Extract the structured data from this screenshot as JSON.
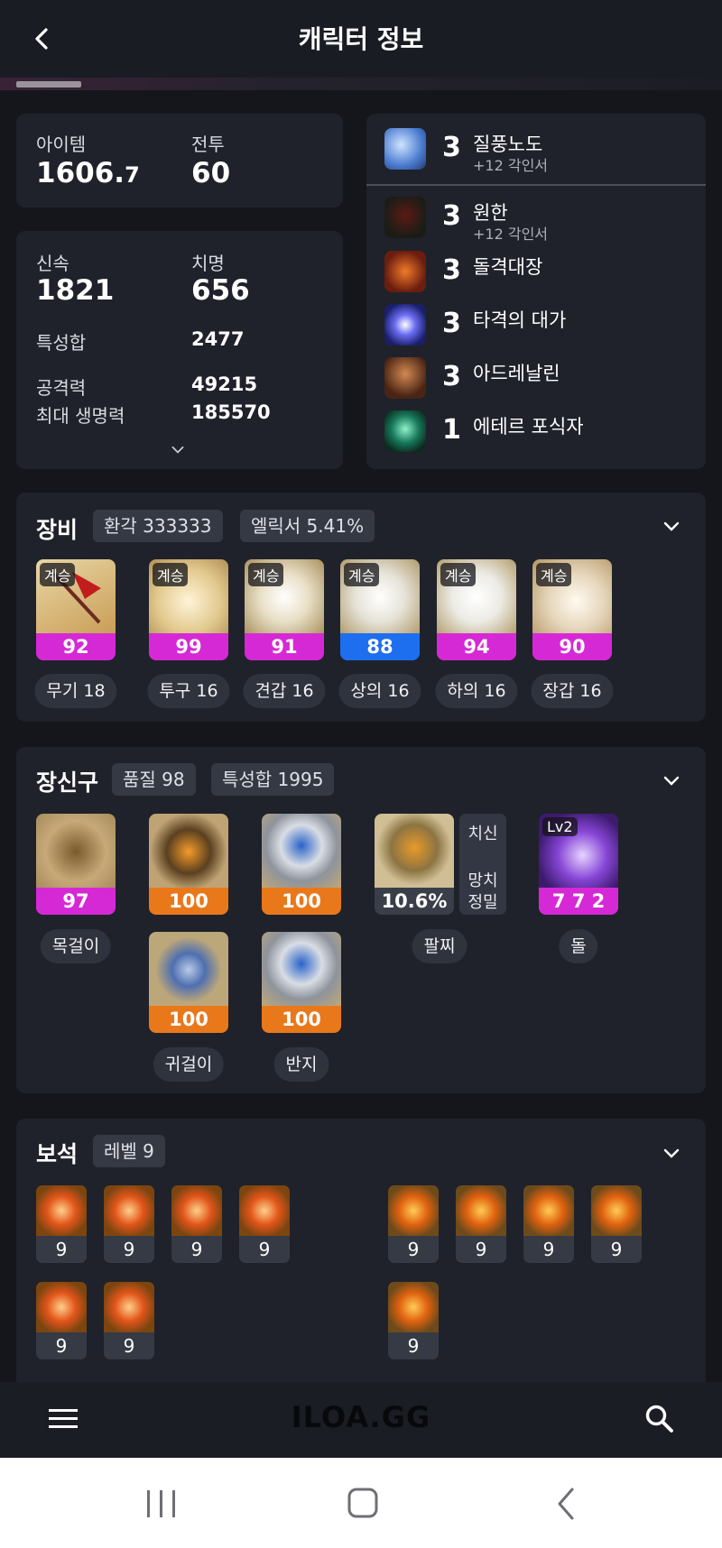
{
  "header": {
    "title": "캐릭터 정보"
  },
  "stats_top": {
    "item_label": "아이템",
    "item_value": "1606.",
    "item_value_decimal": "7",
    "combat_label": "전투",
    "combat_value": "60"
  },
  "stats": {
    "swiftness_label": "신속",
    "swiftness_value": "1821",
    "crit_label": "치명",
    "crit_value": "656",
    "total_label": "특성합",
    "total_value": "2477",
    "attack_label": "공격력",
    "attack_value": "49215",
    "hp_label": "최대 생명력",
    "hp_value": "185570"
  },
  "engravings": [
    {
      "level": "3",
      "name": "질풍노도",
      "sub": "+12 각인서",
      "icon": "wind-engraving-icon"
    },
    {
      "level": "3",
      "name": "원한",
      "sub": "+12 각인서",
      "icon": "grudge-engraving-icon"
    },
    {
      "level": "3",
      "name": "돌격대장",
      "sub": "",
      "icon": "raid-captain-engraving-icon"
    },
    {
      "level": "3",
      "name": "타격의 대가",
      "sub": "",
      "icon": "hit-master-engraving-icon"
    },
    {
      "level": "3",
      "name": "아드레날린",
      "sub": "",
      "icon": "adrenaline-engraving-icon"
    },
    {
      "level": "1",
      "name": "에테르 포식자",
      "sub": "",
      "icon": "ether-predator-engraving-icon"
    }
  ],
  "equipment": {
    "title": "장비",
    "pill1": "환각 333333",
    "pill2": "엘릭서 5.41%",
    "items": [
      {
        "tag": "계승",
        "quality": "92",
        "caption": "무기 18",
        "color": "#d629d6"
      },
      {
        "tag": "계승",
        "quality": "99",
        "caption": "투구 16",
        "color": "#d629d6"
      },
      {
        "tag": "계승",
        "quality": "91",
        "caption": "견갑 16",
        "color": "#d629d6"
      },
      {
        "tag": "계승",
        "quality": "88",
        "caption": "상의 16",
        "color": "#1e6ef0"
      },
      {
        "tag": "계승",
        "quality": "94",
        "caption": "하의 16",
        "color": "#d629d6"
      },
      {
        "tag": "계승",
        "quality": "90",
        "caption": "장갑 16",
        "color": "#d629d6"
      }
    ]
  },
  "accessories": {
    "title": "장신구",
    "pill1": "품질 98",
    "pill2": "특성합 1995",
    "necklace": {
      "quality": "97",
      "caption": "목걸이"
    },
    "earring1": {
      "quality": "100"
    },
    "earring2": {
      "quality": "100",
      "caption": "귀걸이"
    },
    "ring1": {
      "quality": "100"
    },
    "ring2": {
      "quality": "100",
      "caption": "반지"
    },
    "bracelet": {
      "value": "10.6%",
      "caption": "팔찌",
      "stat1": "치신",
      "stat2a": "망치",
      "stat2b": "정밀"
    },
    "stone": {
      "tag": "Lv2",
      "value": "7 7 2",
      "caption": "돌"
    }
  },
  "gems": {
    "title": "보석",
    "pill": "레벨 9",
    "left": [
      "9",
      "9",
      "9",
      "9",
      "9",
      "9"
    ],
    "right": [
      "9",
      "9",
      "9",
      "9",
      "9"
    ]
  },
  "bottom": {
    "logo": "ILOA.GG"
  }
}
